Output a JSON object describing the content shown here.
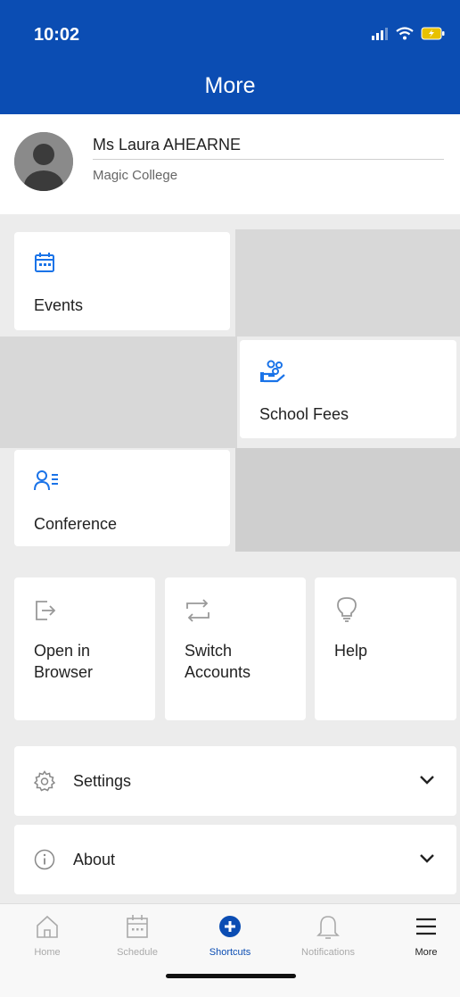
{
  "status_bar": {
    "time": "10:02",
    "icons": [
      "signal-icon",
      "wifi-icon",
      "battery-icon"
    ]
  },
  "header": {
    "title": "More"
  },
  "profile": {
    "name": "Ms Laura AHEARNE",
    "school": "Magic College"
  },
  "shortcuts": [
    {
      "label": "Events",
      "icon": "calendar-icon"
    },
    {
      "label": "School Fees",
      "icon": "fees-icon"
    },
    {
      "label": "Conference",
      "icon": "conference-icon"
    }
  ],
  "actions": [
    {
      "label_lines": [
        "Open in",
        "Browser"
      ],
      "icon": "open-browser-icon"
    },
    {
      "label_lines": [
        "Switch",
        "Accounts"
      ],
      "icon": "switch-accounts-icon"
    },
    {
      "label_lines": [
        "Help"
      ],
      "icon": "lightbulb-icon"
    }
  ],
  "accordions": [
    {
      "label": "Settings",
      "icon": "gear-icon"
    },
    {
      "label": "About",
      "icon": "info-icon"
    }
  ],
  "tabbar": {
    "active": "Shortcuts",
    "items": [
      {
        "label": "Home",
        "icon": "home-icon"
      },
      {
        "label": "Schedule",
        "icon": "calendar-icon"
      },
      {
        "label": "Shortcuts",
        "icon": "plus-circle-icon"
      },
      {
        "label": "Notifications",
        "icon": "bell-icon"
      },
      {
        "label": "More",
        "icon": "menu-icon"
      }
    ]
  },
  "colors": {
    "brand": "#0b4db3",
    "accent": "#1a73e8",
    "background": "#ececec",
    "tile": "#ffffff",
    "tile_placeholder": "#d8d8d8"
  }
}
